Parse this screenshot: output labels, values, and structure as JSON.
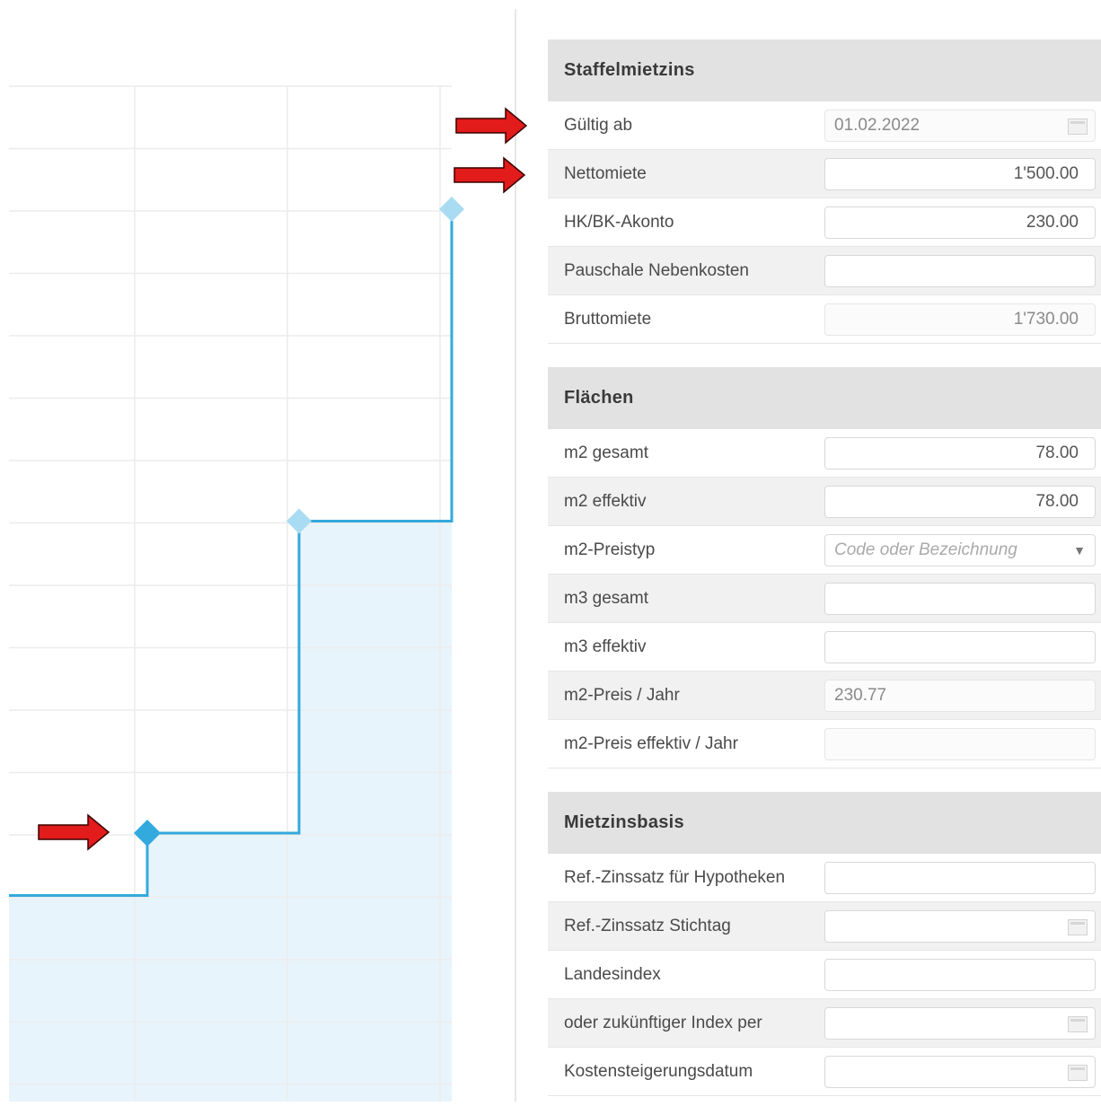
{
  "sections": [
    {
      "title": "Staffelmietzins",
      "rows": [
        {
          "label": "Gültig ab",
          "value": "01.02.2022",
          "placeholder": "",
          "align": "left",
          "readonly": true,
          "calendar": true,
          "dropdown": false
        },
        {
          "label": "Nettomiete",
          "value": "1'500.00",
          "placeholder": "",
          "align": "right",
          "readonly": false,
          "calendar": false,
          "dropdown": false
        },
        {
          "label": "HK/BK-Akonto",
          "value": "230.00",
          "placeholder": "",
          "align": "right",
          "readonly": false,
          "calendar": false,
          "dropdown": false
        },
        {
          "label": "Pauschale Nebenkosten",
          "value": "",
          "placeholder": "",
          "align": "right",
          "readonly": false,
          "calendar": false,
          "dropdown": false
        },
        {
          "label": "Bruttomiete",
          "value": "1'730.00",
          "placeholder": "",
          "align": "right",
          "readonly": true,
          "calendar": false,
          "dropdown": false
        }
      ]
    },
    {
      "title": "Flächen",
      "rows": [
        {
          "label": "m2 gesamt",
          "value": "78.00",
          "placeholder": "",
          "align": "right",
          "readonly": false,
          "calendar": false,
          "dropdown": false
        },
        {
          "label": "m2 effektiv",
          "value": "78.00",
          "placeholder": "",
          "align": "right",
          "readonly": false,
          "calendar": false,
          "dropdown": false
        },
        {
          "label": "m2-Preistyp",
          "value": "",
          "placeholder": "Code oder Bezeichnung",
          "align": "left",
          "readonly": false,
          "calendar": false,
          "dropdown": true
        },
        {
          "label": "m3 gesamt",
          "value": "",
          "placeholder": "",
          "align": "right",
          "readonly": false,
          "calendar": false,
          "dropdown": false
        },
        {
          "label": "m3 effektiv",
          "value": "",
          "placeholder": "",
          "align": "right",
          "readonly": false,
          "calendar": false,
          "dropdown": false
        },
        {
          "label": "m2-Preis / Jahr",
          "value": "230.77",
          "placeholder": "",
          "align": "left",
          "readonly": true,
          "calendar": false,
          "dropdown": false
        },
        {
          "label": "m2-Preis effektiv / Jahr",
          "value": "",
          "placeholder": "",
          "align": "left",
          "readonly": true,
          "calendar": false,
          "dropdown": false
        }
      ]
    },
    {
      "title": "Mietzinsbasis",
      "rows": [
        {
          "label": "Ref.-Zinssatz für Hypotheken",
          "value": "",
          "placeholder": "",
          "align": "right",
          "readonly": false,
          "calendar": false,
          "dropdown": false
        },
        {
          "label": "Ref.-Zinssatz Stichtag",
          "value": "",
          "placeholder": "",
          "align": "left",
          "readonly": false,
          "calendar": true,
          "dropdown": false
        },
        {
          "label": "Landesindex",
          "value": "",
          "placeholder": "",
          "align": "right",
          "readonly": false,
          "calendar": false,
          "dropdown": false
        },
        {
          "label": "oder zukünftiger Index per",
          "value": "",
          "placeholder": "",
          "align": "left",
          "readonly": false,
          "calendar": true,
          "dropdown": false
        },
        {
          "label": "Kostensteigerungsdatum",
          "value": "",
          "placeholder": "",
          "align": "left",
          "readonly": false,
          "calendar": true,
          "dropdown": false
        }
      ]
    }
  ],
  "chart_data": {
    "type": "area",
    "step": "after",
    "series_color": "#33aadd",
    "fill_color": "#e8f4fb",
    "points": [
      {
        "x": 0,
        "y": 1
      },
      {
        "x": 1,
        "y": 2
      },
      {
        "x": 2,
        "y": 7
      },
      {
        "x": 3,
        "y": 12
      }
    ],
    "xlim": [
      0,
      3
    ],
    "ylim": [
      0,
      13
    ],
    "grid": true,
    "highlight_point_index": 1
  },
  "annotation_color": "#e21b1b"
}
